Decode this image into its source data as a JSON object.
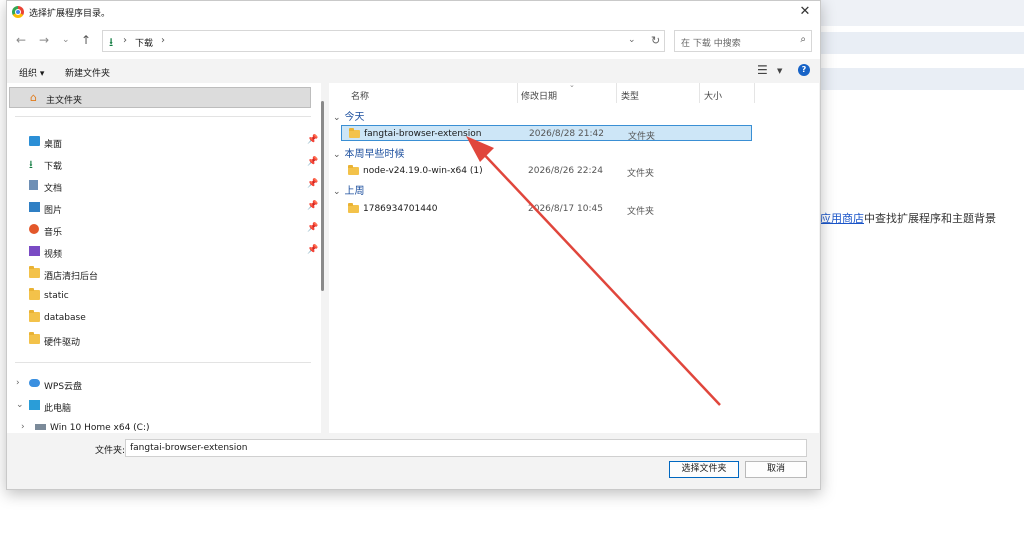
{
  "background": {
    "hint_link": "应用商店",
    "hint_text": "中查找扩展程序和主题背景"
  },
  "dialog": {
    "title": "选择扩展程序目录。",
    "close": "✕",
    "nav": {
      "back": "←",
      "forward": "→",
      "recent": "⌄",
      "up": "↑"
    },
    "address": {
      "segment": "下载",
      "sep": "›",
      "dropdown": "⌄",
      "refresh": "↻"
    },
    "search": {
      "placeholder": "在 下载 中搜索"
    },
    "commands": {
      "organize": "组织 ▾",
      "new_folder": "新建文件夹"
    },
    "sidebar": {
      "home": "主文件夹",
      "quick_access": [
        {
          "label": "桌面",
          "icon": "desktop-icon"
        },
        {
          "label": "下载",
          "icon": "download-icon"
        },
        {
          "label": "文档",
          "icon": "document-icon"
        },
        {
          "label": "图片",
          "icon": "picture-icon"
        },
        {
          "label": "音乐",
          "icon": "music-icon"
        },
        {
          "label": "视频",
          "icon": "video-icon"
        },
        {
          "label": "酒店清扫后台",
          "icon": "folder-icon"
        },
        {
          "label": "static",
          "icon": "folder-icon"
        },
        {
          "label": "database",
          "icon": "folder-icon"
        },
        {
          "label": "硬件驱动",
          "icon": "folder-icon"
        }
      ],
      "wps": "WPS云盘",
      "this_pc": "此电脑",
      "drive": "Win 10 Home x64 (C:)"
    },
    "columns": {
      "name": "名称",
      "date": "修改日期",
      "type": "类型",
      "size": "大小"
    },
    "groups": [
      {
        "label": "今天",
        "items": [
          {
            "name": "fangtai-browser-extension",
            "date": "2026/8/28 21:42",
            "type": "文件夹",
            "selected": true
          }
        ]
      },
      {
        "label": "本周早些时候",
        "items": [
          {
            "name": "node-v24.19.0-win-x64 (1)",
            "date": "2026/8/26 22:24",
            "type": "文件夹",
            "selected": false
          }
        ]
      },
      {
        "label": "上周",
        "items": [
          {
            "name": "1786934701440",
            "date": "2026/8/17 10:45",
            "type": "文件夹",
            "selected": false
          }
        ]
      }
    ],
    "folder_label": "文件夹:",
    "folder_value": "fangtai-browser-extension",
    "select_button": "选择文件夹",
    "cancel_button": "取消"
  },
  "colors": {
    "accent": "#0067c0",
    "annotation_arrow": "#e0463c",
    "folder": "#f3c24a"
  }
}
